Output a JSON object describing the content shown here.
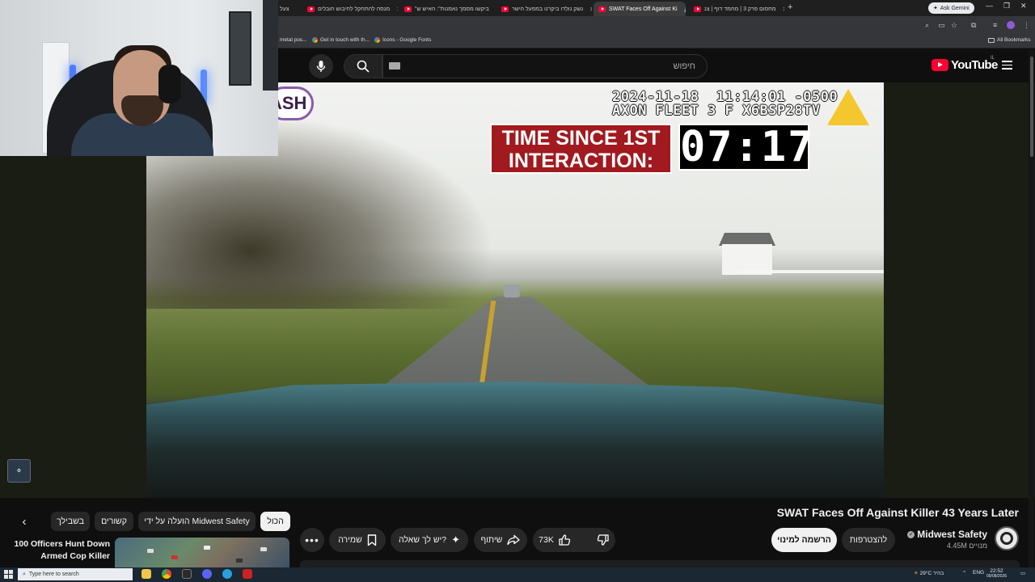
{
  "browser": {
    "tabs": [
      {
        "label": "צעל",
        "active": false
      },
      {
        "label": "מנסה להתחקל לחיבוש חובלים",
        "active": false
      },
      {
        "label": "\"ביקשו מסמך נאמנות\": האיש ש",
        "active": false
      },
      {
        "label": "נשק נולדו ביקרנו במפעל הישר",
        "active": false
      },
      {
        "label": "SWAT Faces Off Against Ki",
        "active": true
      },
      {
        "label": "מחסום פרק 3 | מחמד דוף | צנ",
        "active": false
      }
    ],
    "ask_gemini": "Ask Gemini",
    "bookmarks": [
      "metal pos...",
      "Get in touch with th...",
      "Icons - Google Fonts"
    ],
    "all_bookmarks": "All Bookmarks"
  },
  "youtube": {
    "search_placeholder": "חיפוש",
    "logo_text": "YouTube",
    "logo_country": "IL"
  },
  "video_overlay": {
    "timestamp_line1": "2024-11-18  11:14:01 -0500",
    "timestamp_line2": "AXON FLEET 3 F X6BSP28TV",
    "label": "TIME SINCE 1ST INTERACTION:",
    "timer": "07:17",
    "badge_text": "ASH"
  },
  "video_info": {
    "title": "SWAT Faces Off Against Killer 43 Years Later",
    "channel_name": "Midwest Safety",
    "subscribers": "4.45M מנויים",
    "join_label": "להצטרפות",
    "subscribe_label": "הרשמה למינוי",
    "likes": "73K",
    "share_label": "שיתוף",
    "ask_label": "יש לך שאלה?",
    "save_label": "שמירה",
    "more_label": "•••"
  },
  "chips": [
    {
      "label": "הכול",
      "active": true
    },
    {
      "label": "הועלה על ידי Midwest Safety",
      "active": false
    },
    {
      "label": "קשורים",
      "active": false
    },
    {
      "label": "בשבילך",
      "active": false
    }
  ],
  "recommendation": {
    "title": "100 Officers Hunt Down Armed Cop Killer"
  },
  "taskbar": {
    "search_placeholder": "Type here to search",
    "weather": "29°C  בהיר",
    "language": "ENG",
    "time": "22:52",
    "date": "09/08/2026"
  },
  "colors": {
    "youtube_red": "#ff0033",
    "overlay_red": "#a11a1f",
    "background": "#0f0f0f"
  }
}
